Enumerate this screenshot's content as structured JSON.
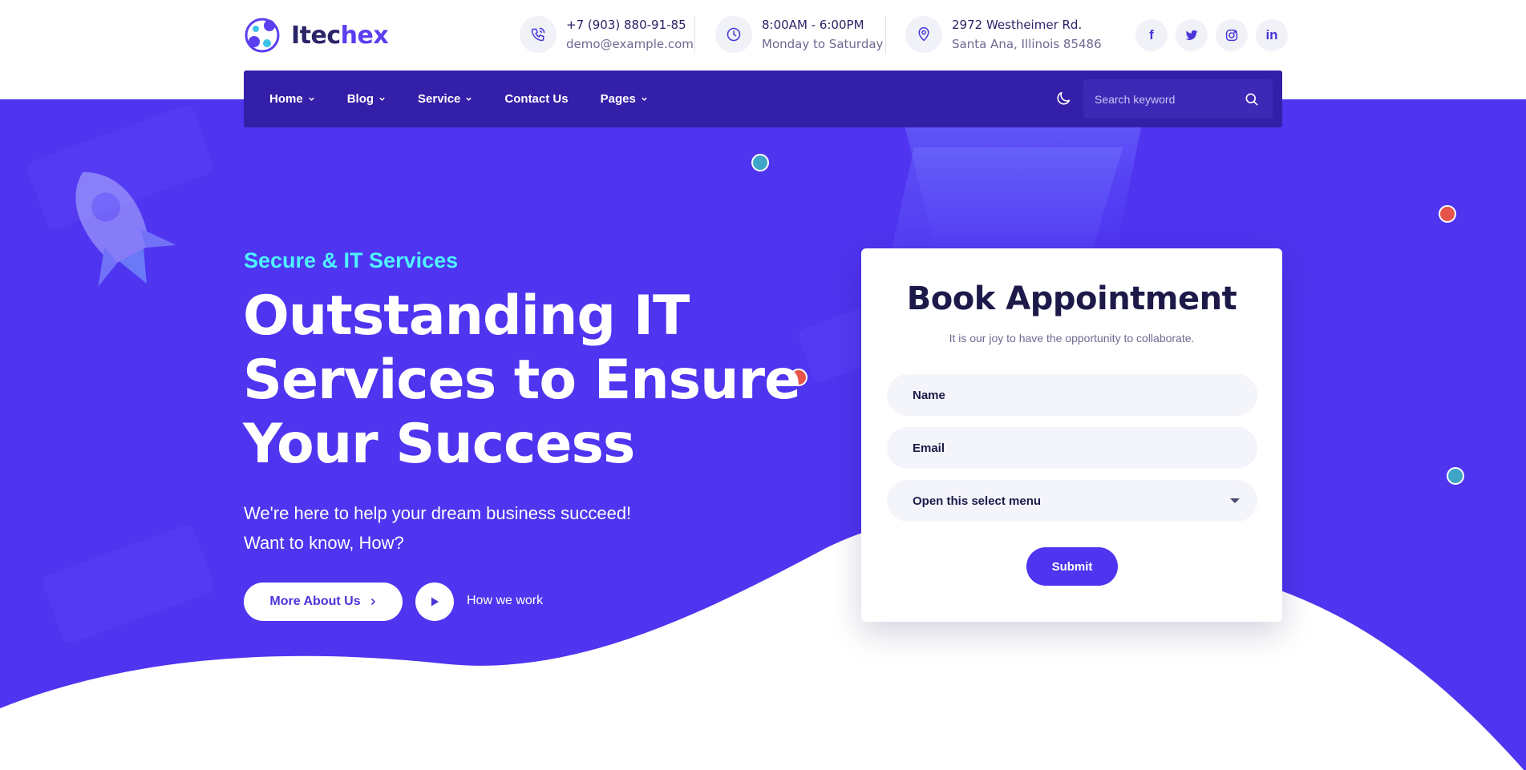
{
  "brand": {
    "name_main": "Itec",
    "name_accent": "hex"
  },
  "contacts": {
    "phone": {
      "line1": "+7 (903) 880-91-85",
      "line2": "demo@example.com",
      "icon": "phone-icon"
    },
    "hours": {
      "line1": "8:00AM - 6:00PM",
      "line2": "Monday to Saturday",
      "icon": "clock-icon"
    },
    "address": {
      "line1": "2972 Westheimer Rd.",
      "line2": "Santa Ana, Illinois 85486",
      "icon": "map-pin-icon"
    }
  },
  "socials": [
    {
      "name": "facebook",
      "glyph": "f"
    },
    {
      "name": "twitter",
      "glyph": ""
    },
    {
      "name": "instagram",
      "glyph": ""
    },
    {
      "name": "linkedin",
      "glyph": "in"
    }
  ],
  "nav": {
    "items": [
      {
        "label": "Home",
        "has_dropdown": true
      },
      {
        "label": "Blog",
        "has_dropdown": true
      },
      {
        "label": "Service",
        "has_dropdown": true
      },
      {
        "label": "Contact Us",
        "has_dropdown": false
      },
      {
        "label": "Pages",
        "has_dropdown": true
      }
    ],
    "search_placeholder": "Search keyword"
  },
  "hero": {
    "eyebrow": "Secure & IT Services",
    "headline": [
      "Outstanding IT",
      "Services to Ensure",
      "Your Success"
    ],
    "subline": [
      "We're here to help your dream business succeed!",
      "Want to know, How?"
    ],
    "primary_button": "More About Us",
    "secondary_link": "How we work"
  },
  "appointment": {
    "title": "Book Appointment",
    "subtitle": "It is our joy to have the opportunity to collaborate.",
    "name_placeholder": "Name",
    "email_placeholder": "Email",
    "select_value": "Open this select menu",
    "submit_label": "Submit"
  },
  "colors": {
    "primary": "#4f34f0",
    "navbar": "#3420a8",
    "eyebrow": "#4ff3ff",
    "heading_dark": "#1d1a4a",
    "dot_red": "#e5534b",
    "dot_teal": "#3fa5c7"
  }
}
